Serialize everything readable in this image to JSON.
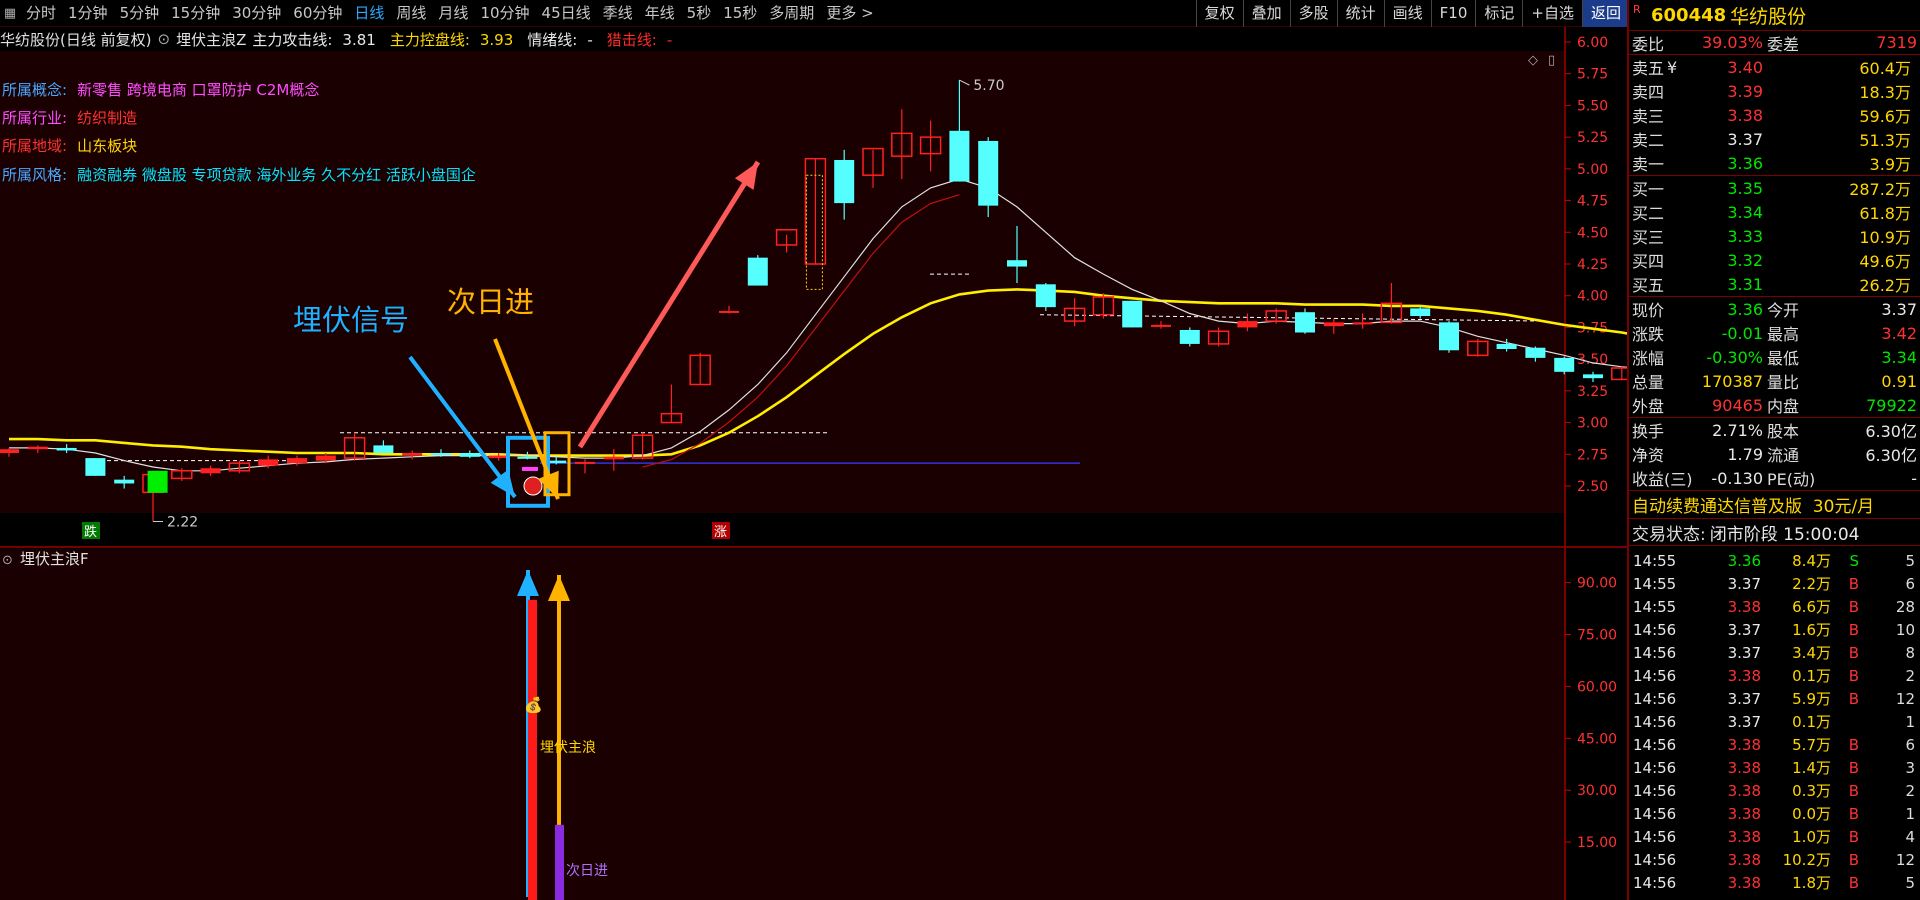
{
  "toolbar": {
    "periods": [
      "分时",
      "1分钟",
      "5分钟",
      "15分钟",
      "30分钟",
      "60分钟",
      "日线",
      "周线",
      "月线",
      "10分钟",
      "45日线",
      "季线",
      "年线",
      "5秒",
      "15秒",
      "多周期",
      "更多 >"
    ],
    "active_period": "日线",
    "right_buttons": [
      "复权",
      "叠加",
      "多股",
      "统计",
      "画线",
      "F10",
      "标记",
      "+自选",
      "返回"
    ],
    "active_right": "返回"
  },
  "chart": {
    "title": "华纺股份(日线 前复权)",
    "indicator_name": "埋伏主浪Z",
    "indicators": [
      {
        "label": "主力攻击线:",
        "value": "3.81",
        "color": "#e8e8e8"
      },
      {
        "label": "主力控盘线:",
        "value": "3.93",
        "color": "#ffd700"
      },
      {
        "label": "情绪线:",
        "value": "-",
        "color": "#e8e8e8"
      },
      {
        "label": "猎击线:",
        "value": "-",
        "color": "#ff2a2a"
      }
    ],
    "tags": [
      {
        "key": "所属概念:",
        "value": "新零售 跨境电商 口罩防护 C2M概念",
        "key_color": "#4aa8ff",
        "value_color": "#ff4dff"
      },
      {
        "key": "所属行业:",
        "value": "纺织制造",
        "key_color": "#ff4dff",
        "value_color": "#ff3232"
      },
      {
        "key": "所属地域:",
        "value": "山东板块",
        "key_color": "#ff3232",
        "value_color": "#ffd700"
      },
      {
        "key": "所属风格:",
        "value": "融资融券 微盘股 专项贷款 海外业务 久不分红 活跃小盘国企",
        "key_color": "#4aa8ff",
        "value_color": "#00e5ff"
      }
    ],
    "price_axis": [
      "6.00",
      "5.75",
      "5.50",
      "5.25",
      "5.00",
      "4.75",
      "4.50",
      "4.25",
      "4.00",
      "3.75",
      "3.50",
      "3.25",
      "3.00",
      "2.75",
      "2.50"
    ],
    "high_label": "5.70",
    "low_label": "2.22",
    "annotations": {
      "signal": "埋伏信号",
      "next_day": "次日进"
    },
    "die_label": "跌",
    "zhang_label": "涨",
    "sub_indicator": "埋伏主浪F",
    "sub_axis": [
      "90.00",
      "75.00",
      "60.00",
      "45.00",
      "30.00",
      "15.00"
    ],
    "sub_labels": {
      "main_wave": "埋伏主浪",
      "next_day": "次日进"
    },
    "colors": {
      "up": "#ff2020",
      "down": "#55ffff",
      "control": "#ffee00",
      "attack": "#e0e0e0",
      "hunt": "#c01010"
    },
    "chart_data": {
      "type": "candlestick",
      "candles": [
        {
          "o": 2.76,
          "h": 2.8,
          "l": 2.73,
          "c": 2.79
        },
        {
          "o": 2.79,
          "h": 2.82,
          "l": 2.76,
          "c": 2.81
        },
        {
          "o": 2.8,
          "h": 2.83,
          "l": 2.76,
          "c": 2.78
        },
        {
          "o": 2.72,
          "h": 2.72,
          "l": 2.58,
          "c": 2.58
        },
        {
          "o": 2.55,
          "h": 2.58,
          "l": 2.48,
          "c": 2.52
        },
        {
          "o": 2.45,
          "h": 2.62,
          "l": 2.22,
          "c": 2.59
        },
        {
          "o": 2.56,
          "h": 2.64,
          "l": 2.54,
          "c": 2.62
        },
        {
          "o": 2.6,
          "h": 2.66,
          "l": 2.58,
          "c": 2.64
        },
        {
          "o": 2.62,
          "h": 2.7,
          "l": 2.6,
          "c": 2.68
        },
        {
          "o": 2.66,
          "h": 2.74,
          "l": 2.64,
          "c": 2.71
        },
        {
          "o": 2.68,
          "h": 2.74,
          "l": 2.66,
          "c": 2.72
        },
        {
          "o": 2.7,
          "h": 2.76,
          "l": 2.68,
          "c": 2.74
        },
        {
          "o": 2.72,
          "h": 2.92,
          "l": 2.7,
          "c": 2.88
        },
        {
          "o": 2.82,
          "h": 2.86,
          "l": 2.76,
          "c": 2.76
        },
        {
          "o": 2.74,
          "h": 2.78,
          "l": 2.71,
          "c": 2.76
        },
        {
          "o": 2.76,
          "h": 2.79,
          "l": 2.73,
          "c": 2.75
        },
        {
          "o": 2.76,
          "h": 2.78,
          "l": 2.72,
          "c": 2.73
        },
        {
          "o": 2.72,
          "h": 2.76,
          "l": 2.7,
          "c": 2.74
        },
        {
          "o": 2.73,
          "h": 2.77,
          "l": 2.71,
          "c": 2.72
        },
        {
          "o": 2.7,
          "h": 2.73,
          "l": 2.67,
          "c": 2.68
        },
        {
          "o": 2.68,
          "h": 2.71,
          "l": 2.6,
          "c": 2.69
        },
        {
          "o": 2.71,
          "h": 2.79,
          "l": 2.62,
          "c": 2.73
        },
        {
          "o": 2.72,
          "h": 2.92,
          "l": 2.71,
          "c": 2.9
        },
        {
          "o": 3.0,
          "h": 3.3,
          "l": 3.0,
          "c": 3.07
        },
        {
          "o": 3.3,
          "h": 3.55,
          "l": 3.3,
          "c": 3.53
        },
        {
          "o": 3.88,
          "h": 3.92,
          "l": 3.86,
          "c": 3.88
        },
        {
          "o": 4.3,
          "h": 4.32,
          "l": 4.08,
          "c": 4.08
        },
        {
          "o": 4.4,
          "h": 4.48,
          "l": 4.34,
          "c": 4.52
        },
        {
          "o": 4.25,
          "h": 5.08,
          "l": 4.25,
          "c": 5.08
        },
        {
          "o": 5.07,
          "h": 5.15,
          "l": 4.6,
          "c": 4.73
        },
        {
          "o": 4.95,
          "h": 5.15,
          "l": 4.85,
          "c": 5.16
        },
        {
          "o": 5.1,
          "h": 5.47,
          "l": 4.92,
          "c": 5.28
        },
        {
          "o": 5.12,
          "h": 5.38,
          "l": 4.98,
          "c": 5.25
        },
        {
          "o": 5.3,
          "h": 5.7,
          "l": 4.9,
          "c": 4.9
        },
        {
          "o": 5.22,
          "h": 5.25,
          "l": 4.62,
          "c": 4.71
        },
        {
          "o": 4.28,
          "h": 4.55,
          "l": 4.1,
          "c": 4.23
        },
        {
          "o": 4.09,
          "h": 4.1,
          "l": 3.88,
          "c": 3.91
        },
        {
          "o": 3.8,
          "h": 3.98,
          "l": 3.76,
          "c": 3.9
        },
        {
          "o": 3.85,
          "h": 4.02,
          "l": 3.82,
          "c": 3.99
        },
        {
          "o": 3.96,
          "h": 3.96,
          "l": 3.75,
          "c": 3.75
        },
        {
          "o": 3.77,
          "h": 3.8,
          "l": 3.74,
          "c": 3.77
        },
        {
          "o": 3.73,
          "h": 3.75,
          "l": 3.6,
          "c": 3.62
        },
        {
          "o": 3.62,
          "h": 3.75,
          "l": 3.6,
          "c": 3.72
        },
        {
          "o": 3.75,
          "h": 3.86,
          "l": 3.72,
          "c": 3.8
        },
        {
          "o": 3.8,
          "h": 3.9,
          "l": 3.78,
          "c": 3.88
        },
        {
          "o": 3.87,
          "h": 3.9,
          "l": 3.7,
          "c": 3.71
        },
        {
          "o": 3.76,
          "h": 3.82,
          "l": 3.7,
          "c": 3.79
        },
        {
          "o": 3.79,
          "h": 3.86,
          "l": 3.74,
          "c": 3.79
        },
        {
          "o": 3.79,
          "h": 4.1,
          "l": 3.78,
          "c": 3.94
        },
        {
          "o": 3.9,
          "h": 3.92,
          "l": 3.82,
          "c": 3.84
        },
        {
          "o": 3.79,
          "h": 3.8,
          "l": 3.55,
          "c": 3.57
        },
        {
          "o": 3.53,
          "h": 3.66,
          "l": 3.52,
          "c": 3.64
        },
        {
          "o": 3.62,
          "h": 3.66,
          "l": 3.56,
          "c": 3.58
        },
        {
          "o": 3.59,
          "h": 3.6,
          "l": 3.48,
          "c": 3.51
        },
        {
          "o": 3.51,
          "h": 3.52,
          "l": 3.38,
          "c": 3.4
        },
        {
          "o": 3.38,
          "h": 3.4,
          "l": 3.32,
          "c": 3.35
        },
        {
          "o": 3.34,
          "h": 3.44,
          "l": 3.34,
          "c": 3.43
        },
        {
          "o": 3.42,
          "h": 3.48,
          "l": 3.4,
          "c": 3.45
        },
        {
          "o": 3.47,
          "h": 3.5,
          "l": 3.4,
          "c": 3.44
        }
      ],
      "control_line": [
        2.87,
        2.87,
        2.86,
        2.86,
        2.84,
        2.82,
        2.81,
        2.79,
        2.78,
        2.77,
        2.76,
        2.76,
        2.76,
        2.75,
        2.75,
        2.75,
        2.75,
        2.75,
        2.74,
        2.74,
        2.74,
        2.74,
        2.74,
        2.75,
        2.82,
        2.92,
        3.05,
        3.2,
        3.37,
        3.54,
        3.7,
        3.83,
        3.94,
        4.01,
        4.04,
        4.05,
        4.04,
        4.03,
        4.0,
        3.98,
        3.96,
        3.95,
        3.94,
        3.94,
        3.94,
        3.93,
        3.93,
        3.93,
        3.92,
        3.92,
        3.9,
        3.88,
        3.85,
        3.81,
        3.77,
        3.74,
        3.71,
        3.67,
        3.65
      ],
      "attack_line": [
        2.8,
        2.8,
        2.79,
        2.76,
        2.7,
        2.65,
        2.62,
        2.62,
        2.64,
        2.66,
        2.68,
        2.69,
        2.71,
        2.72,
        2.73,
        2.74,
        2.74,
        2.74,
        2.74,
        2.73,
        2.72,
        2.72,
        2.74,
        2.8,
        2.93,
        3.1,
        3.3,
        3.55,
        3.85,
        4.15,
        4.45,
        4.7,
        4.85,
        4.92,
        4.85,
        4.7,
        4.5,
        4.3,
        4.17,
        4.05,
        3.96,
        3.86,
        3.8,
        3.78,
        3.8,
        3.79,
        3.78,
        3.78,
        3.8,
        3.8,
        3.75,
        3.68,
        3.63,
        3.58,
        3.53,
        3.47,
        3.44,
        3.42,
        3.45
      ],
      "ylim": [
        2.2,
        6.1
      ],
      "sub_ylim": [
        0,
        100
      ],
      "sub_bars": [
        {
          "index": 19,
          "value": 85,
          "color": "red"
        },
        {
          "index": 20,
          "value": 20,
          "color": "purple"
        }
      ]
    }
  },
  "panel": {
    "stock_code": "600448",
    "stock_name": "华纺股份",
    "r_mark": "R",
    "weibi": {
      "label": "委比",
      "value": "39.03%",
      "label2": "委差",
      "value2": "7319"
    },
    "asks": [
      {
        "label": "卖五",
        "sub": "¥",
        "price": "3.40",
        "vol": "60.4万",
        "color": "red"
      },
      {
        "label": "卖四",
        "sub": "",
        "price": "3.39",
        "vol": "18.3万",
        "color": "red"
      },
      {
        "label": "卖三",
        "sub": "",
        "price": "3.38",
        "vol": "59.6万",
        "color": "red"
      },
      {
        "label": "卖二",
        "sub": "",
        "price": "3.37",
        "vol": "51.3万",
        "color": "white"
      },
      {
        "label": "卖一",
        "sub": "",
        "price": "3.36",
        "vol": "3.9万",
        "color": "green"
      }
    ],
    "bids": [
      {
        "label": "买一",
        "price": "3.35",
        "vol": "287.2万",
        "color": "green"
      },
      {
        "label": "买二",
        "price": "3.34",
        "vol": "61.8万",
        "color": "green"
      },
      {
        "label": "买三",
        "price": "3.33",
        "vol": "10.9万",
        "color": "green"
      },
      {
        "label": "买四",
        "price": "3.32",
        "vol": "49.6万",
        "color": "green"
      },
      {
        "label": "买五",
        "price": "3.31",
        "vol": "26.2万",
        "color": "green"
      }
    ],
    "stats": [
      {
        "l1": "现价",
        "v1": "3.36",
        "c1": "green",
        "l2": "今开",
        "v2": "3.37",
        "c2": "white"
      },
      {
        "l1": "涨跌",
        "v1": "-0.01",
        "c1": "green",
        "l2": "最高",
        "v2": "3.42",
        "c2": "red"
      },
      {
        "l1": "涨幅",
        "v1": "-0.30%",
        "c1": "green",
        "l2": "最低",
        "v2": "3.34",
        "c2": "green"
      },
      {
        "l1": "总量",
        "v1": "170387",
        "c1": "yellow",
        "l2": "量比",
        "v2": "0.91",
        "c2": "yellow"
      },
      {
        "l1": "外盘",
        "v1": "90465",
        "c1": "red",
        "l2": "内盘",
        "v2": "79922",
        "c2": "green"
      }
    ],
    "stats2": [
      {
        "l1": "换手",
        "v1": "2.71%",
        "c1": "white",
        "l2": "股本",
        "v2": "6.30亿",
        "c2": "white"
      },
      {
        "l1": "净资",
        "v1": "1.79",
        "c1": "white",
        "l2": "流通",
        "v2": "6.30亿",
        "c2": "white"
      },
      {
        "l1": "收益(三)",
        "v1": "-0.130",
        "c1": "white",
        "l2": "PE(动)",
        "v2": "-",
        "c2": "white"
      }
    ],
    "promo": "自动续费通达信普及版  30元/月",
    "trade_status_label": "交易状态:",
    "trade_status": "闭市阶段 15:00:04",
    "ticks": [
      {
        "t": "14:55",
        "p": "3.36",
        "pc": "green",
        "v": "8.4万",
        "d": "S",
        "dc": "green",
        "n": "5"
      },
      {
        "t": "14:55",
        "p": "3.37",
        "pc": "white",
        "v": "2.2万",
        "d": "B",
        "dc": "red",
        "n": "6"
      },
      {
        "t": "14:55",
        "p": "3.38",
        "pc": "red",
        "v": "6.6万",
        "d": "B",
        "dc": "red",
        "n": "28"
      },
      {
        "t": "14:56",
        "p": "3.37",
        "pc": "white",
        "v": "1.6万",
        "d": "B",
        "dc": "red",
        "n": "10"
      },
      {
        "t": "14:56",
        "p": "3.37",
        "pc": "white",
        "v": "3.4万",
        "d": "B",
        "dc": "red",
        "n": "8"
      },
      {
        "t": "14:56",
        "p": "3.38",
        "pc": "red",
        "v": "0.1万",
        "d": "B",
        "dc": "red",
        "n": "2"
      },
      {
        "t": "14:56",
        "p": "3.37",
        "pc": "white",
        "v": "5.9万",
        "d": "B",
        "dc": "red",
        "n": "12"
      },
      {
        "t": "14:56",
        "p": "3.37",
        "pc": "white",
        "v": "0.1万",
        "d": "",
        "dc": "white",
        "n": "1"
      },
      {
        "t": "14:56",
        "p": "3.38",
        "pc": "red",
        "v": "5.7万",
        "d": "B",
        "dc": "red",
        "n": "6"
      },
      {
        "t": "14:56",
        "p": "3.38",
        "pc": "red",
        "v": "1.4万",
        "d": "B",
        "dc": "red",
        "n": "3"
      },
      {
        "t": "14:56",
        "p": "3.38",
        "pc": "red",
        "v": "0.3万",
        "d": "B",
        "dc": "red",
        "n": "2"
      },
      {
        "t": "14:56",
        "p": "3.38",
        "pc": "red",
        "v": "0.0万",
        "d": "B",
        "dc": "red",
        "n": "1"
      },
      {
        "t": "14:56",
        "p": "3.38",
        "pc": "red",
        "v": "1.0万",
        "d": "B",
        "dc": "red",
        "n": "4"
      },
      {
        "t": "14:56",
        "p": "3.38",
        "pc": "red",
        "v": "10.2万",
        "d": "B",
        "dc": "red",
        "n": "12"
      },
      {
        "t": "14:56",
        "p": "3.38",
        "pc": "red",
        "v": "1.8万",
        "d": "B",
        "dc": "red",
        "n": "5"
      }
    ]
  }
}
